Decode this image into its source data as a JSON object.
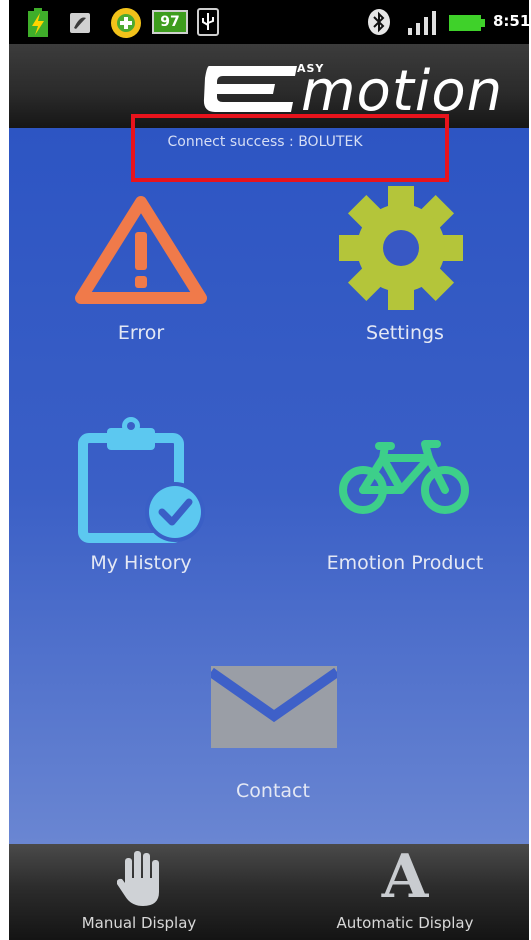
{
  "status_bar": {
    "battery_level": "97",
    "time": "8:51",
    "icons": [
      "charging-icon",
      "sim-icon",
      "app-notification-icon",
      "battery-icon",
      "usb-icon",
      "bluetooth-icon",
      "signal-icon",
      "battery-status-icon"
    ]
  },
  "header": {
    "logo_prefix": "ASY",
    "logo_text": "motion"
  },
  "connection": {
    "status_text": "Connect success : BOLUTEK"
  },
  "menu": {
    "error": "Error",
    "settings": "Settings",
    "history": "My History",
    "product": "Emotion Product",
    "contact": "Contact"
  },
  "bottom_bar": {
    "manual": "Manual Display",
    "automatic": "Automatic Display",
    "automatic_glyph": "A"
  },
  "colors": {
    "error_icon": "#f07a4a",
    "settings_icon": "#b4c53a",
    "history_icon": "#5cc8f0",
    "product_icon": "#3dcf8a",
    "contact_icon": "#9a9ea6",
    "highlight_box": "#e8131c"
  }
}
